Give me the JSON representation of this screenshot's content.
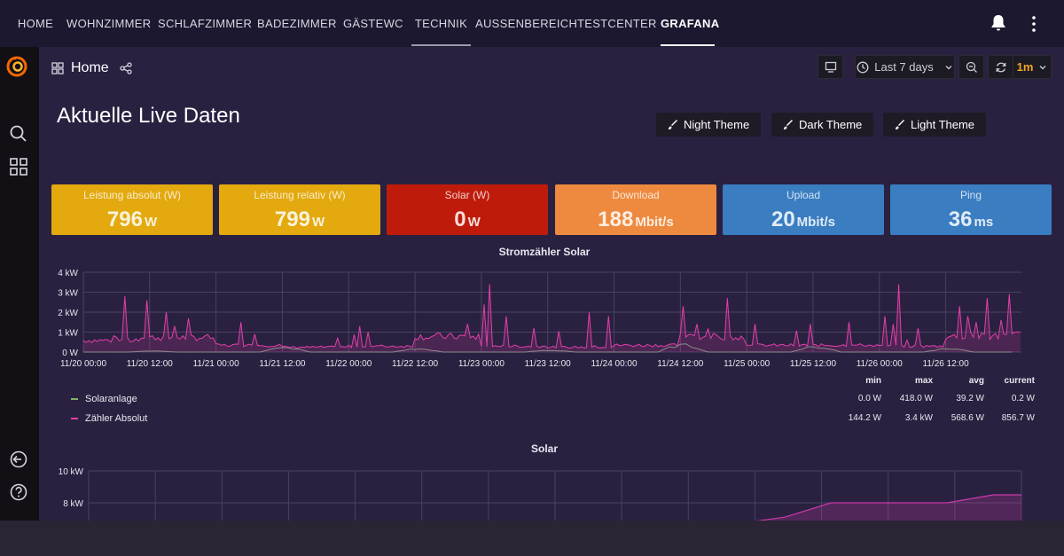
{
  "nav": {
    "tabs": [
      {
        "label": "HOME",
        "active": false
      },
      {
        "label": "WOHNZIMMER",
        "active": false
      },
      {
        "label": "SCHLAFZIMMER",
        "active": false
      },
      {
        "label": "BADEZIMMER",
        "active": false
      },
      {
        "label": "GÄSTEWC",
        "active": false
      },
      {
        "label": "TECHNIK",
        "active": false,
        "underline": true
      },
      {
        "label": "AUSSENBEREICH",
        "active": false
      },
      {
        "label": "TESTCENTER",
        "active": false
      },
      {
        "label": "GRAFANA",
        "active": true,
        "underline": true
      }
    ],
    "bell_icon": "bell-icon",
    "menu_icon": "kebab-menu-icon"
  },
  "sidebar": {
    "logo_icon": "grafana-logo-icon",
    "items": [
      "search-icon",
      "dashboards-icon",
      "sign-out-icon",
      "help-icon"
    ]
  },
  "toolbar": {
    "breadcrumb": "Home",
    "time_range": "Last 7 days",
    "refresh_interval": "1m"
  },
  "dashboard": {
    "title": "Aktuelle Live Daten",
    "theme_buttons": [
      "Night Theme",
      "Dark Theme",
      "Light Theme"
    ]
  },
  "stats": [
    {
      "label": "Leistung absolut (W)",
      "value": "796",
      "unit": "W",
      "color": "#e3a90f"
    },
    {
      "label": "Leistung relativ (W)",
      "value": "799",
      "unit": "W",
      "color": "#e3a90f"
    },
    {
      "label": "Solar (W)",
      "value": "0",
      "unit": "W",
      "color": "#bf1b0b"
    },
    {
      "label": "Download",
      "value": "188",
      "unit": "Mbit/s",
      "color": "#ee8a3f"
    },
    {
      "label": "Upload",
      "value": "20",
      "unit": "Mbit/s",
      "color": "#3a7dc1"
    },
    {
      "label": "Ping",
      "value": "36",
      "unit": "ms",
      "color": "#3a7dc1"
    }
  ],
  "chart_data": [
    {
      "type": "line",
      "title": "Stromzähler Solar",
      "y_ticks": [
        "4 kW",
        "3 kW",
        "2 kW",
        "1 kW",
        "0 W"
      ],
      "ylim": [
        0,
        4000
      ],
      "x_ticks": [
        "11/20 00:00",
        "11/20 12:00",
        "11/21 00:00",
        "11/21 12:00",
        "11/22 00:00",
        "11/22 12:00",
        "11/23 00:00",
        "11/23 12:00",
        "11/24 00:00",
        "11/24 12:00",
        "11/25 00:00",
        "11/25 12:00",
        "11/26 00:00",
        "11/26 12:00"
      ],
      "grid": true,
      "legend_placement": "bottom",
      "legend_columns": [
        "min",
        "max",
        "avg",
        "current"
      ],
      "series": [
        {
          "name": "Solaranlage",
          "color": "#7eb26d",
          "min": "0.0 W",
          "max": "418.0 W",
          "avg": "39.2 W",
          "current": "0.2 W",
          "peaks_hours": [
            2,
            30,
            54,
            78,
            102,
            126,
            150
          ],
          "peak_values": [
            60,
            250,
            180,
            100,
            420,
            300,
            200
          ]
        },
        {
          "name": "Zähler Absolut",
          "color": "#e23fa8",
          "min": "144.2 W",
          "max": "3.4 kW",
          "avg": "568.6 W",
          "current": "856.7 W",
          "base": [
            600,
            750,
            350,
            250,
            300,
            800,
            300,
            250,
            350,
            800,
            350,
            350,
            300,
            800,
            850
          ],
          "spikes": [
            [
              9,
              2800
            ],
            [
              14,
              2600
            ],
            [
              18,
              2000
            ],
            [
              20,
              1300
            ],
            [
              34,
              1500
            ],
            [
              37,
              900
            ],
            [
              60,
              1300
            ],
            [
              62,
              1000
            ],
            [
              87,
              2400
            ],
            [
              88,
              3400
            ],
            [
              92,
              1800
            ],
            [
              98,
              1200
            ],
            [
              110,
              2000
            ],
            [
              114,
              1800
            ],
            [
              130,
              2300
            ],
            [
              133,
              1400
            ],
            [
              140,
              2700
            ],
            [
              146,
              1400
            ],
            [
              158,
              1400
            ],
            [
              166,
              1500
            ],
            [
              174,
              1800
            ],
            [
              176,
              1400
            ],
            [
              177,
              3400
            ],
            [
              181,
              1200
            ],
            [
              190,
              2300
            ],
            [
              192,
              1800
            ],
            [
              194,
              1500
            ],
            [
              196,
              2700
            ],
            [
              199,
              1600
            ],
            [
              201,
              2900
            ]
          ]
        }
      ]
    },
    {
      "type": "area",
      "title": "Solar",
      "y_ticks": [
        "10 kW",
        "8 kW"
      ],
      "ylim": [
        0,
        10000
      ],
      "grid": true,
      "series": [
        {
          "name": "",
          "color": "#c93aa8",
          "x_hours": [
            0,
            110,
            140,
            150,
            160,
            170,
            185,
            195,
            201
          ],
          "y": [
            6400,
            6700,
            6700,
            7100,
            8000,
            8000,
            8000,
            8500,
            8500
          ]
        }
      ]
    }
  ]
}
